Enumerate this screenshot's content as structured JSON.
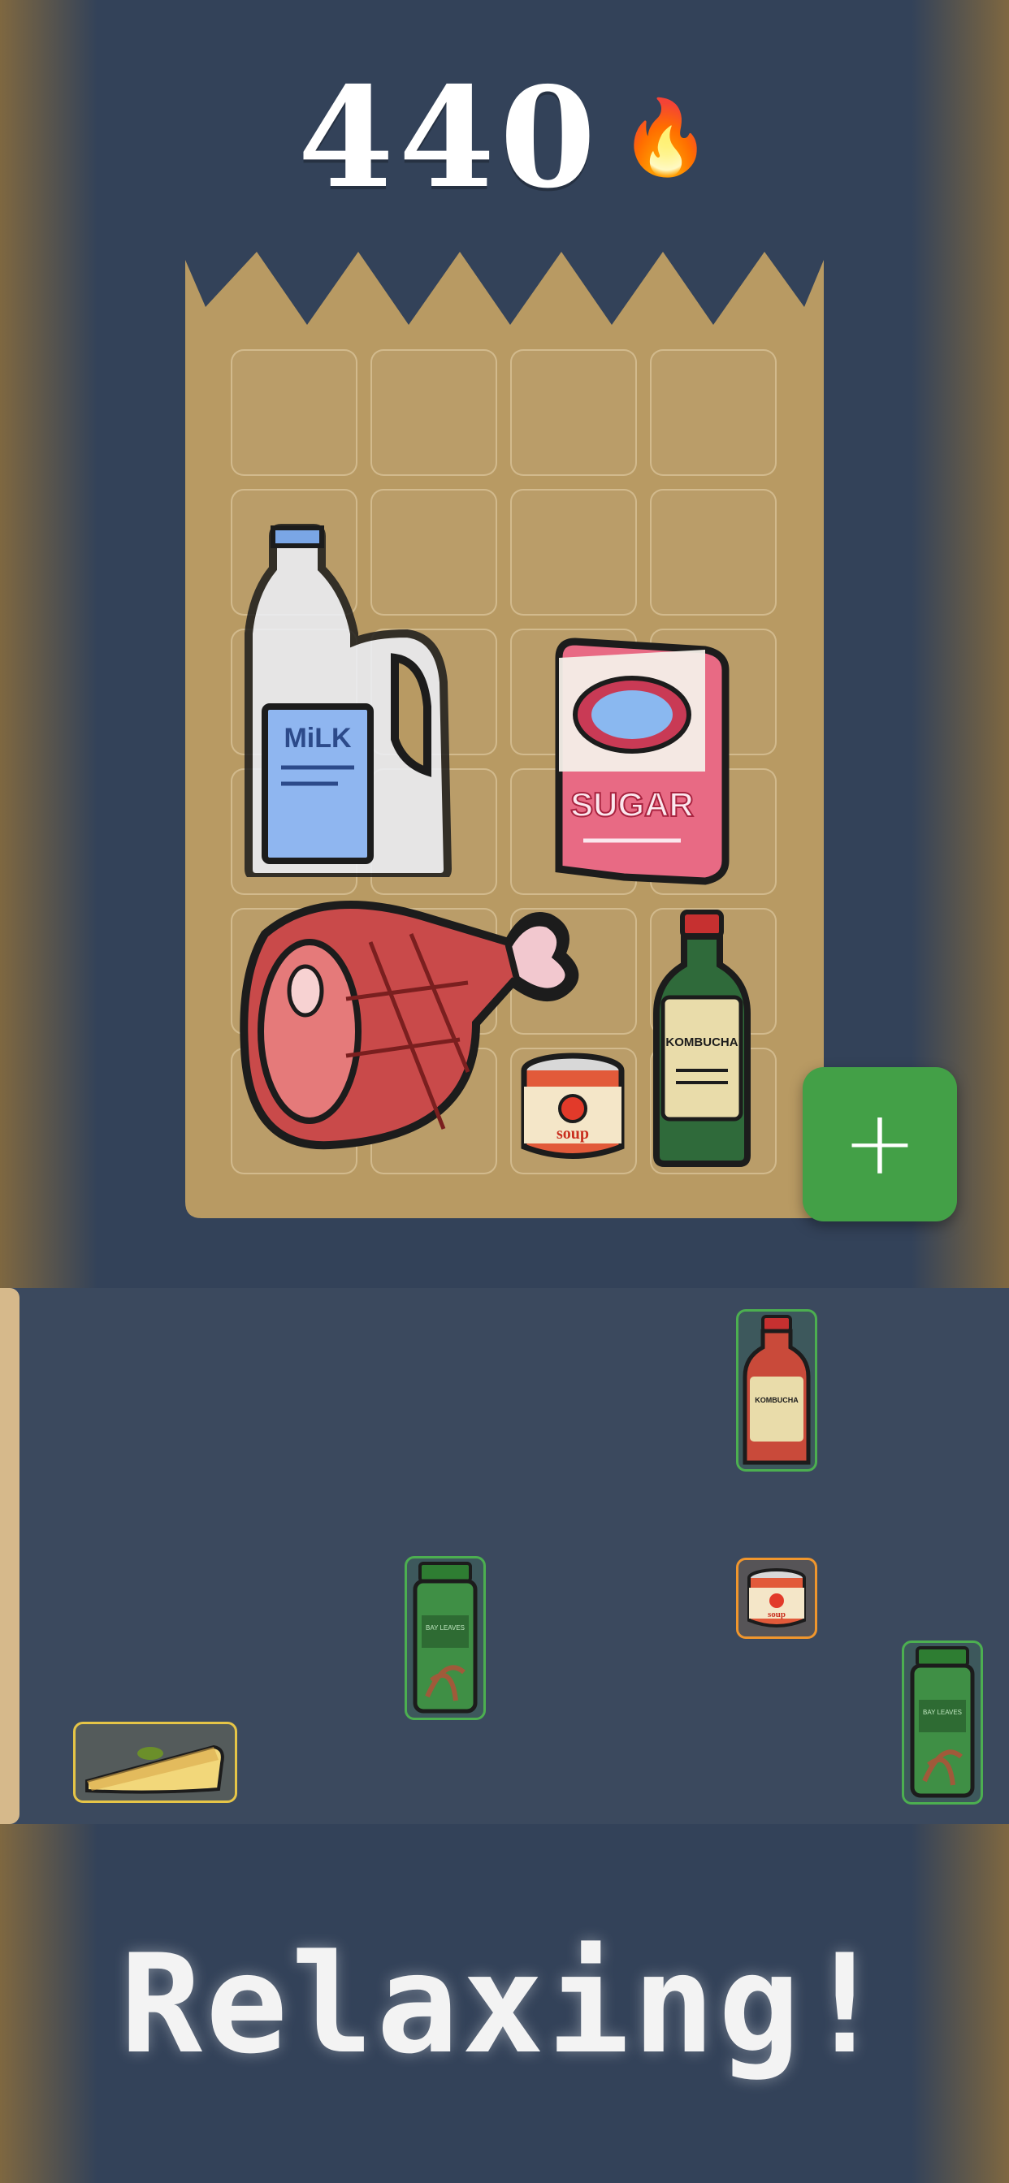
{
  "hud": {
    "score": "440",
    "streak_icon": "fire-icon"
  },
  "bag": {
    "grid_rows": 6,
    "grid_cols": 4,
    "placed_items": [
      {
        "name": "milk",
        "label": "MiLK",
        "icon": "milk-jug-icon"
      },
      {
        "name": "sugar",
        "label": "SUGAR",
        "icon": "sugar-bag-icon"
      },
      {
        "name": "ham",
        "icon": "ham-leg-icon"
      },
      {
        "name": "kombucha",
        "label": "KOMBUCHA",
        "icon": "bottle-icon"
      },
      {
        "name": "soup",
        "label": "soup",
        "icon": "soup-can-icon"
      }
    ]
  },
  "add_button": {
    "label": "+"
  },
  "tray": {
    "items": [
      {
        "name": "kombucha",
        "label": "KOMBUCHA",
        "icon": "bottle-icon",
        "color": "#4caf50"
      },
      {
        "name": "bay-leaves",
        "label": "BAY LEAVES",
        "icon": "jar-icon",
        "color": "#4caf50"
      },
      {
        "name": "soup",
        "label": "soup",
        "icon": "soup-can-icon",
        "color": "#f0962d"
      },
      {
        "name": "bay-leaves",
        "label": "BAY LEAVES",
        "icon": "jar-icon",
        "color": "#4caf50"
      },
      {
        "name": "pie-slice",
        "icon": "pie-icon",
        "color": "#e6c547"
      }
    ]
  },
  "tagline": "Relaxing!",
  "colors": {
    "background": "#334259",
    "bag": "#b89a63",
    "add_button": "#43a047",
    "tray": "#3b495e"
  }
}
